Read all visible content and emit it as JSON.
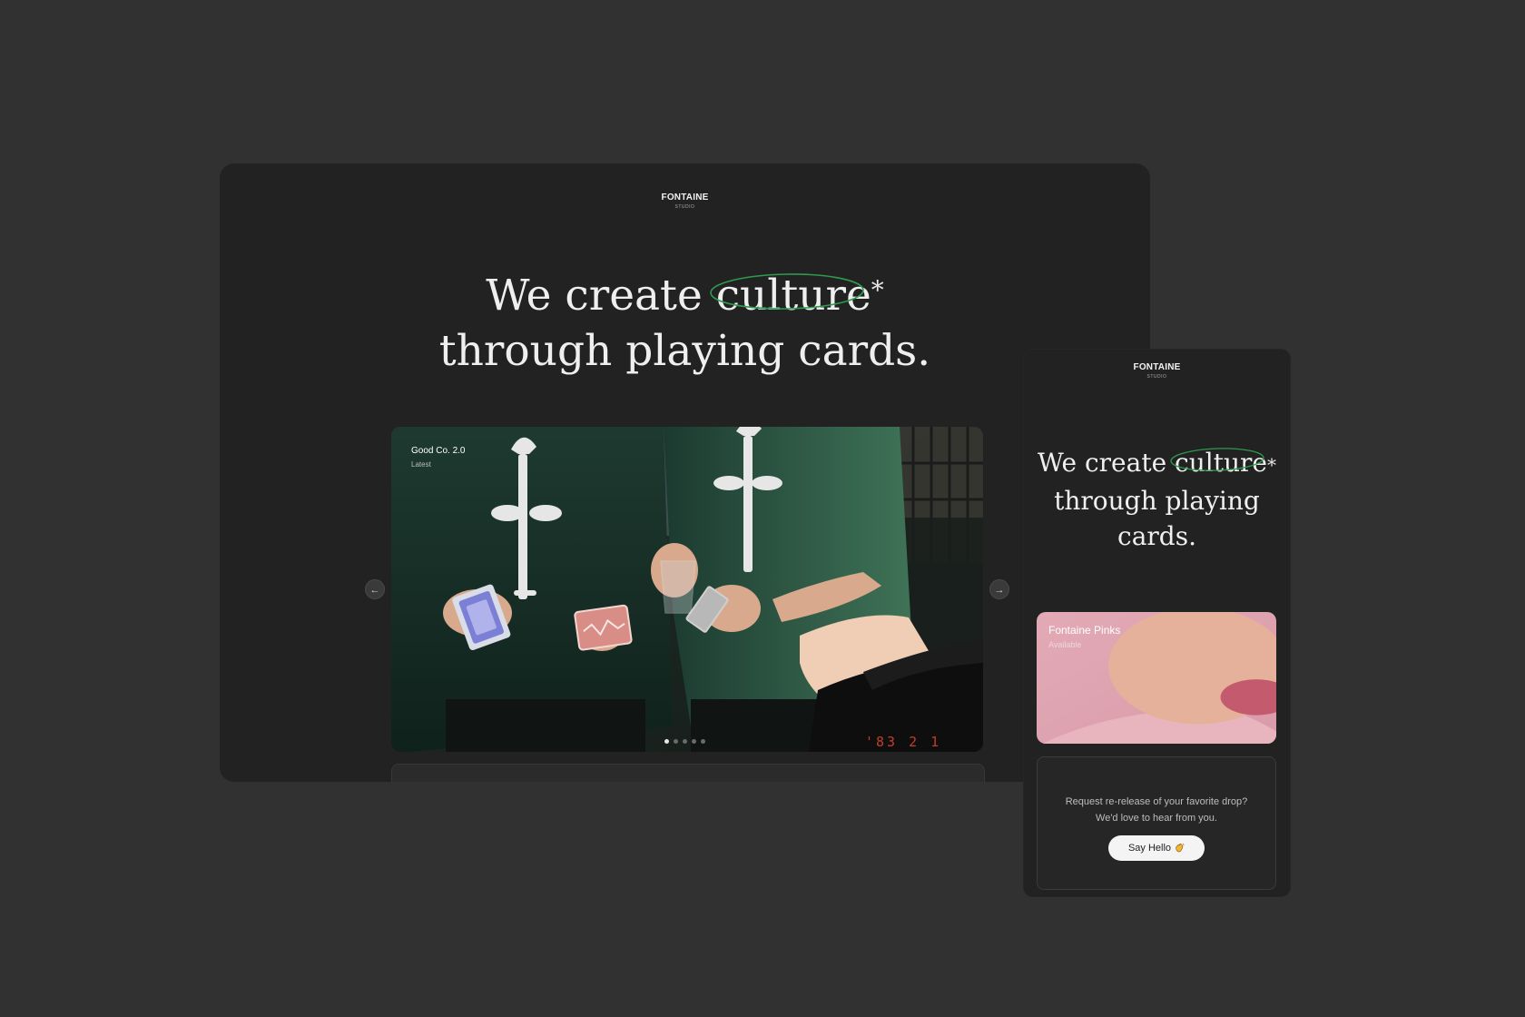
{
  "desktop": {
    "brand": {
      "name": "FONTAINE",
      "sub": "STUDIO"
    },
    "hero": {
      "line1_prefix": "We create ",
      "highlight": "culture",
      "asterisk": "*",
      "line2": "through playing cards."
    },
    "carousel": {
      "slide_title": "Good Co. 2.0",
      "slide_subtitle": "Latest",
      "date_stamp": "'83 2 1",
      "prev_icon": "←",
      "next_icon": "→",
      "active_slide": 1,
      "slide_count": 5
    }
  },
  "mobile": {
    "brand": {
      "name": "FONTAINE",
      "sub": "STUDIO"
    },
    "hero": {
      "line1_prefix": "We create ",
      "highlight": "culture",
      "asterisk": "*",
      "line2": "through playing",
      "line3": "cards."
    },
    "product": {
      "title": "Fontaine Pinks",
      "status": "Available"
    },
    "contact": {
      "line1": "Request re-release of your favorite drop?",
      "line2": "We'd love to hear from you.",
      "button_label": "Say Hello",
      "button_icon": "waving-hand-icon"
    }
  },
  "colors": {
    "background": "#313131",
    "panel": "#222222",
    "highlight_ellipse": "#2e9a4e",
    "date_stamp": "#e0472e",
    "button": "#f4f4f4"
  }
}
